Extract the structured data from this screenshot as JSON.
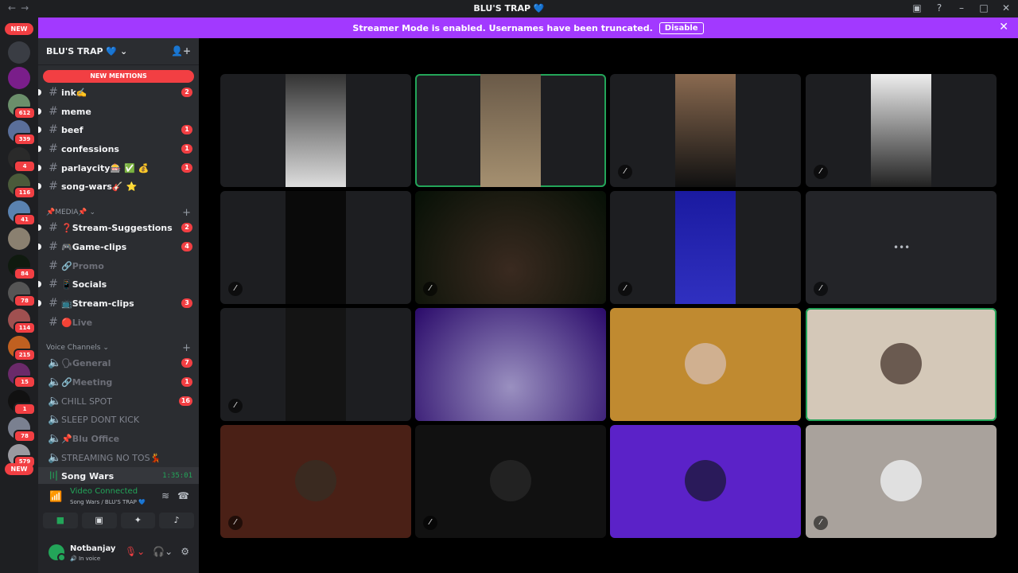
{
  "window": {
    "title": "BLU'S TRAP 💙"
  },
  "banner": {
    "text": "Streamer Mode is enabled. Usernames have been truncated.",
    "button": "Disable"
  },
  "guilds": {
    "new_top": "NEW",
    "new_bottom": "NEW",
    "badges": [
      "612",
      "339",
      "4",
      "116",
      "41",
      "84",
      "78",
      "114",
      "215",
      "15",
      "1",
      "78",
      "579"
    ]
  },
  "server": {
    "name": "BLU'S TRAP 💙 ⌄",
    "new_mentions": "NEW MENTIONS"
  },
  "channels": [
    {
      "name": "ink✍️",
      "badge": "2"
    },
    {
      "name": "meme",
      "badge": ""
    },
    {
      "name": "beef",
      "badge": "1"
    },
    {
      "name": "confessions",
      "badge": "1"
    },
    {
      "name": "parlaycity🎰 ✅ 💰",
      "badge": "1"
    },
    {
      "name": "song-wars🎸 ⭐",
      "badge": ""
    }
  ],
  "media_category": "📌MEDIA📌",
  "media_channels": [
    {
      "name": "❓Stream-Suggestions",
      "badge": "2"
    },
    {
      "name": "🎮Game-clips",
      "badge": "4"
    },
    {
      "name": "🔗Promo",
      "badge": ""
    },
    {
      "name": "📱Socials",
      "badge": ""
    },
    {
      "name": "📺Stream-clips",
      "badge": "3"
    },
    {
      "name": "🔴Live",
      "badge": ""
    }
  ],
  "voice_category": "Voice Channels",
  "voice_channels": [
    {
      "name": "🗣General",
      "badge": "7"
    },
    {
      "name": "🔗Meeting",
      "badge": "1"
    },
    {
      "name": "CHILL SPOT",
      "badge": "16"
    },
    {
      "name": "SLEEP DONT KICK",
      "badge": ""
    },
    {
      "name": "📌Blu Office",
      "badge": ""
    },
    {
      "name": "STREAMING NO TOS💃",
      "badge": ""
    },
    {
      "name": "Song Wars",
      "timer": "1:35:01"
    }
  ],
  "voice_panel": {
    "status": "Video Connected",
    "location": "Song Wars / BLU'S TRAP 💙"
  },
  "user": {
    "name": "Notbanjay",
    "status": "🔊 In voice"
  },
  "colors": {
    "accent": "#a239ff",
    "danger": "#f23f43",
    "green": "#23a559",
    "sidebar": "#2b2d31",
    "guilds": "#1e1f22"
  },
  "icons": [
    "back-icon",
    "forward-icon",
    "inbox-icon",
    "help-icon",
    "minimize-icon",
    "maximize-icon",
    "close-icon",
    "hash-icon",
    "speaker-icon",
    "mic-muted-icon",
    "headphones-icon",
    "settings-icon",
    "camera-icon",
    "screen-share-icon",
    "activities-icon",
    "soundboard-icon"
  ]
}
